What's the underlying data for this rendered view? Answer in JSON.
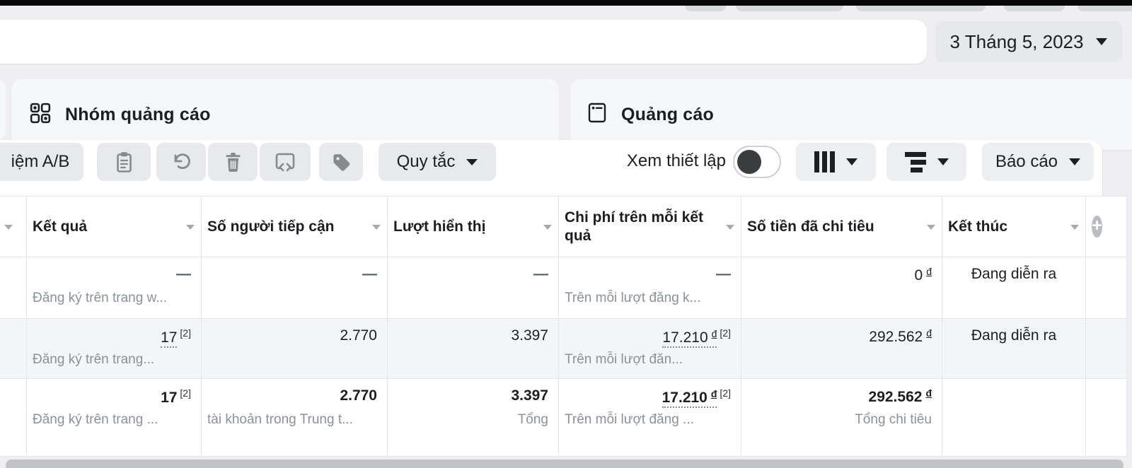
{
  "date_button": {
    "label": "3 Tháng 5, 2023"
  },
  "tabs": {
    "adsets": "Nhóm quảng cáo",
    "ads": "Quảng cáo"
  },
  "toolbar": {
    "ab_test": "iệm A/B",
    "rules": "Quy tắc",
    "view_setup": "Xem thiết lập",
    "report": "Báo cáo"
  },
  "table": {
    "headers": {
      "results": "Kết quả",
      "reach": "Số người tiếp cận",
      "impressions": "Lượt hiển thị",
      "cost_per_result": "Chi phí trên mỗi kết quả",
      "amount_spent": "Số tiền đã chi tiêu",
      "ends": "Kết thúc"
    },
    "rows": [
      {
        "results": "—",
        "results_sub": "Đăng ký trên trang w...",
        "reach": "—",
        "impressions": "—",
        "cost": "—",
        "cost_sub": "Trên mỗi lượt đăng k...",
        "spent": "0",
        "spent_currency": "đ",
        "ends": "Đang diễn ra"
      },
      {
        "results": "17",
        "results_ref": "[2]",
        "results_sub": "Đăng ký trên trang...",
        "reach": "2.770",
        "impressions": "3.397",
        "cost": "17.210",
        "cost_currency": "đ",
        "cost_ref": "[2]",
        "cost_sub": "Trên mỗi lượt đăn...",
        "spent": "292.562",
        "spent_currency": "đ",
        "ends": "Đang diễn ra"
      }
    ],
    "totals": {
      "results": "17",
      "results_ref": "[2]",
      "results_sub": "Đăng ký trên trang ...",
      "reach": "2.770",
      "reach_sub": "tài khoản trong Trung t...",
      "impressions": "3.397",
      "impressions_sub": "Tổng",
      "cost": "17.210",
      "cost_currency": "đ",
      "cost_ref": "[2]",
      "cost_sub": "Trên mỗi lượt đăng ...",
      "spent": "292.562",
      "spent_currency": "đ",
      "spent_sub": "Tổng chi tiêu"
    }
  },
  "colors": {
    "toolbar_button_bg": "#e7e9ec",
    "highlight_row_bg": "#f4f5f6",
    "muted_text": "#8b9199"
  }
}
